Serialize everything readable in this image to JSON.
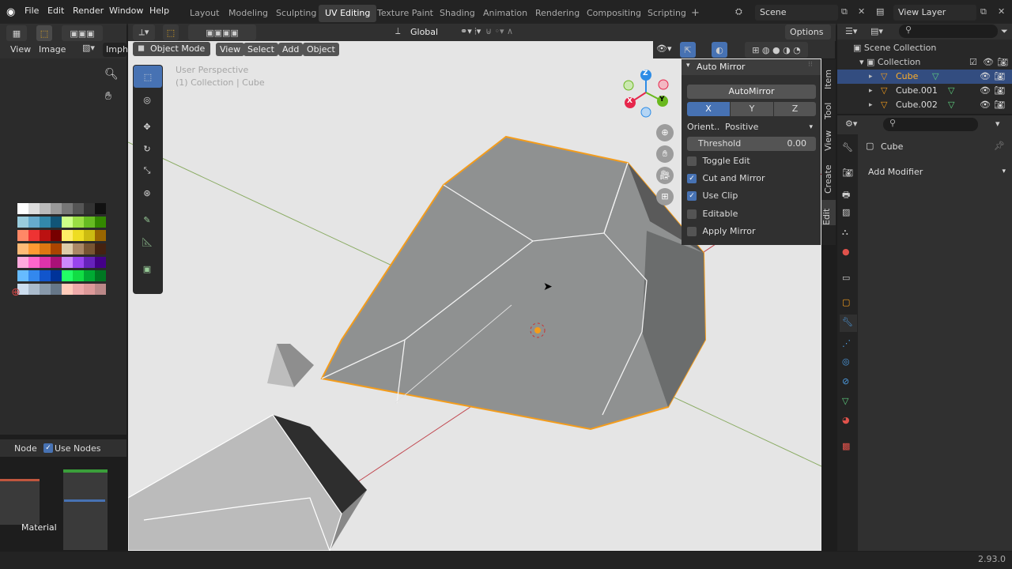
{
  "topbar": {
    "menus": [
      "File",
      "Edit",
      "Render",
      "Window",
      "Help"
    ],
    "workspaces": [
      "Layout",
      "Modeling",
      "Sculpting",
      "UV Editing",
      "Texture Paint",
      "Shading",
      "Animation",
      "Rendering",
      "Compositing",
      "Scripting"
    ],
    "active_workspace": "UV Editing",
    "add": "+",
    "scene": "Scene",
    "view_layer": "View Layer"
  },
  "left": {
    "view": "View",
    "image": "Image",
    "image_field": "Imph",
    "node": "Node",
    "use_nodes": "Use Nodes",
    "material": "Material"
  },
  "viewport": {
    "mode": "Object Mode",
    "menus": [
      "View",
      "Select",
      "Add",
      "Object"
    ],
    "transform": "Global",
    "options": "Options",
    "overlay1": "User Perspective",
    "overlay2": "(1) Collection | Cube"
  },
  "gizmo": {
    "x": "X",
    "y": "Y",
    "z": "Z"
  },
  "automirror": {
    "title": "Auto Mirror",
    "button": "AutoMirror",
    "axes": [
      "X",
      "Y",
      "Z"
    ],
    "orient_label": "Orient...",
    "orient_value": "Positive",
    "threshold_label": "Threshold",
    "threshold_value": "0.00",
    "options": [
      {
        "label": "Toggle Edit",
        "on": false
      },
      {
        "label": "Cut and Mirror",
        "on": true
      },
      {
        "label": "Use Clip",
        "on": true
      },
      {
        "label": "Editable",
        "on": false
      },
      {
        "label": "Apply Mirror",
        "on": false
      }
    ]
  },
  "sidetabs": [
    "Item",
    "Tool",
    "View",
    "Create",
    "Edit"
  ],
  "outliner": {
    "scene_collection": "Scene Collection",
    "collection": "Collection",
    "items": [
      "Cube",
      "Cube.001",
      "Cube.002"
    ]
  },
  "properties": {
    "object": "Cube",
    "add_modifier": "Add Modifier"
  },
  "status": {
    "version": "2.93.0"
  },
  "colors": {
    "accent": "#4772b3",
    "selection": "#f39c1c",
    "bg": "#303030"
  }
}
